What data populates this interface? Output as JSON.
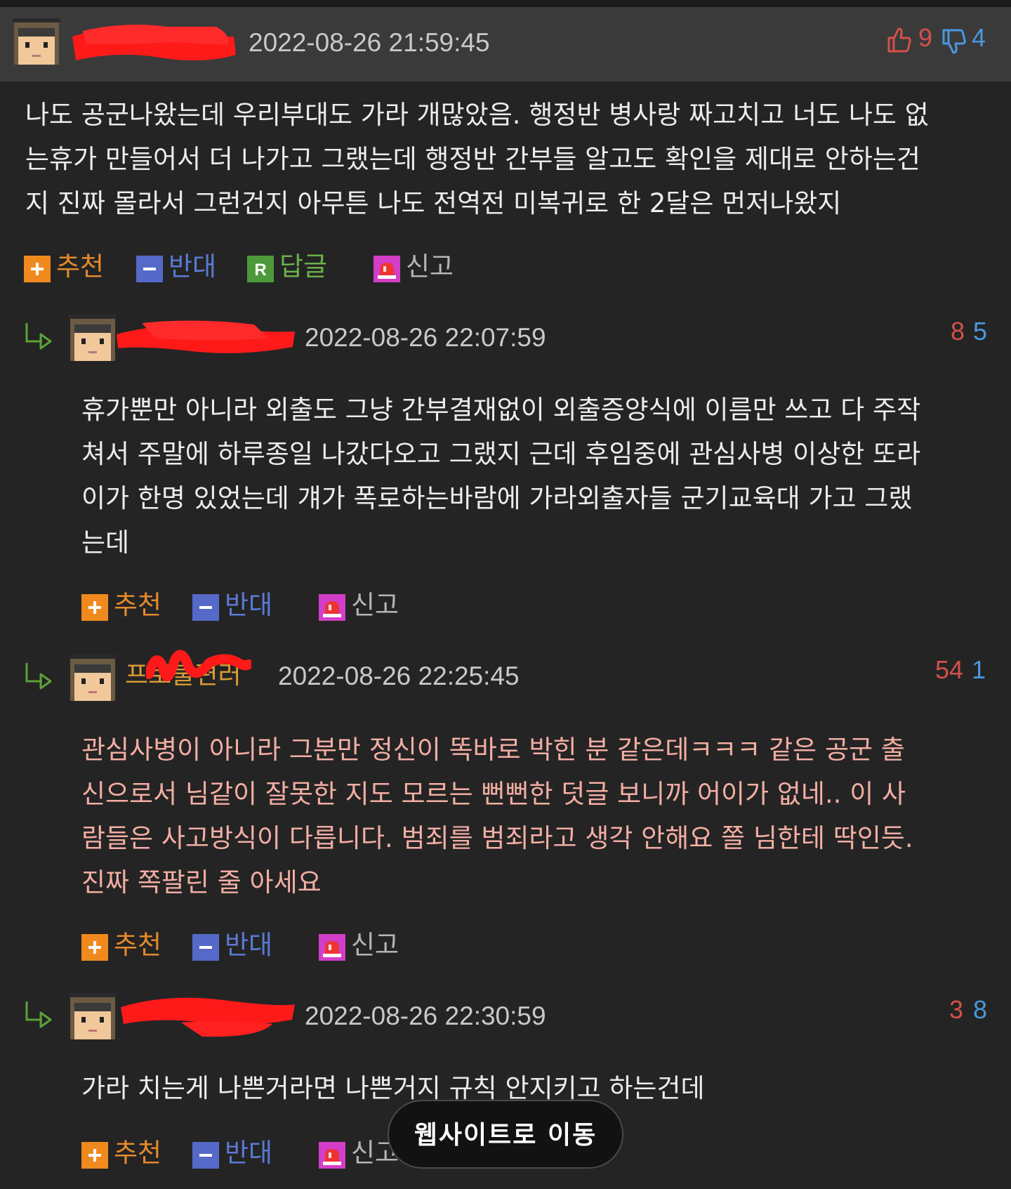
{
  "comments": [
    {
      "timestamp": "2022-08-26 21:59:45",
      "up": "9",
      "down": "4",
      "lines": [
        "나도 공군나왔는데 우리부대도 가라 개많았음. 행정반 병사랑 짜고치고 너도 나도 없",
        "는휴가 만들어서 더 나가고 그랬는데 행정반 간부들 알고도 확인을 제대로 안하는건",
        "지 진짜 몰라서 그런건지 아무튼 나도 전역전 미복귀로 한 2달은 먼저나왔지"
      ],
      "actions": {
        "recommend": "추천",
        "oppose": "반대",
        "reply": "답글",
        "report": "신고"
      }
    },
    {
      "timestamp": "2022-08-26 22:07:59",
      "up": "8",
      "down": "5",
      "lines": [
        "휴가뿐만 아니라 외출도 그냥 간부결재없이 외출증양식에 이름만 쓰고 다 주작",
        "쳐서 주말에 하루종일 나갔다오고 그랬지 근데 후임중에 관심사병 이상한 또라",
        "이가 한명 있었는데 걔가 폭로하는바람에 가라외출자들 군기교육대 가고 그랬",
        "는데"
      ],
      "actions": {
        "recommend": "추천",
        "oppose": "반대",
        "report": "신고"
      }
    },
    {
      "nickname": "프로불편러",
      "timestamp": "2022-08-26 22:25:45",
      "up": "54",
      "down": "1",
      "lines": [
        "관심사병이 아니라 그분만 정신이 똑바로 박힌 분 같은데ㅋㅋㅋ 같은 공군 출",
        "신으로서 님같이 잘못한 지도 모르는 뻔뻔한 덧글 보니까 어이가 없네.. 이 사",
        "람들은 사고방식이 다릅니다. 범죄를 범죄라고 생각 안해요 쫄 님한테 딱인듯.",
        "진짜 쪽팔린 줄 아세요"
      ],
      "actions": {
        "recommend": "추천",
        "oppose": "반대",
        "report": "신고"
      }
    },
    {
      "timestamp": "2022-08-26 22:30:59",
      "up": "3",
      "down": "8",
      "lines": [
        "가라 치는게 나쁜거라면 나쁜거지 규칙 안지키고 하는건데"
      ],
      "actions": {
        "recommend": "추천",
        "oppose": "반대",
        "report": "신고"
      }
    }
  ],
  "bottom_button": "웹사이트로 이동",
  "colors": {
    "background": "#242424",
    "header": "#3a3a3a",
    "up": "#d4504a",
    "down": "#4a98de",
    "recommend": "#e58a2c",
    "oppose": "#5a7ad6",
    "reply": "#6ab04a",
    "highlight_text": "#f3aea3",
    "redaction": "#ff1a1a"
  }
}
